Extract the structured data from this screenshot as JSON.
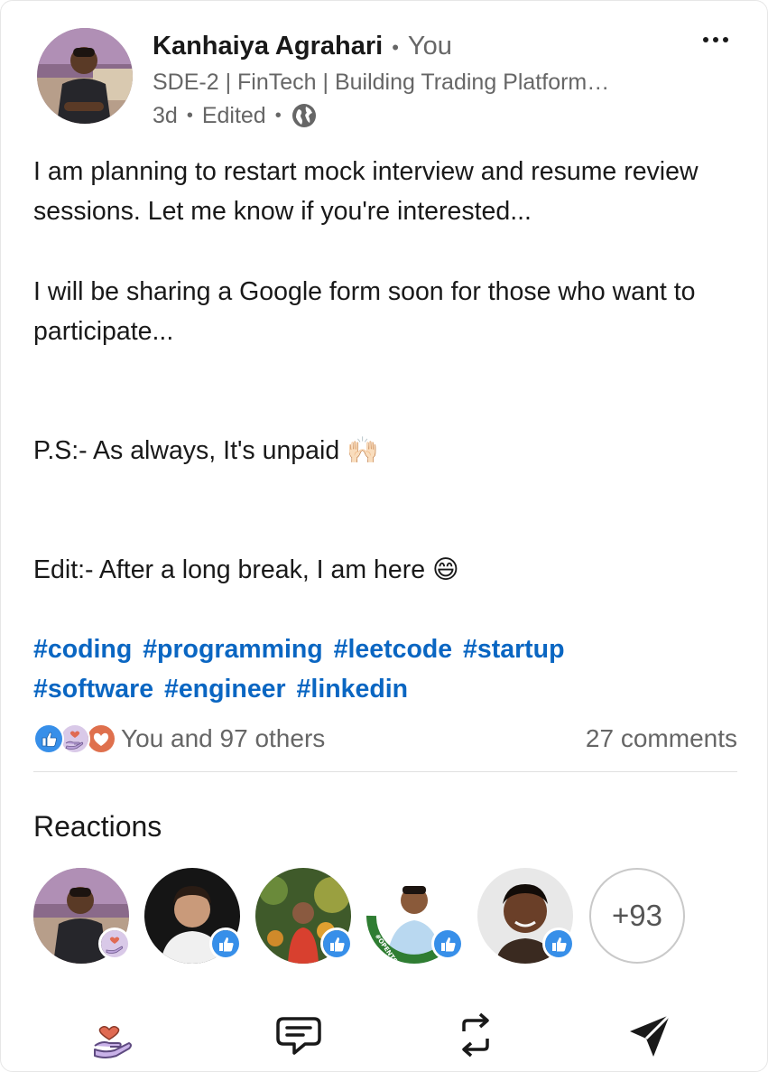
{
  "author": {
    "name": "Kanhaiya Agrahari",
    "relation_sep": "•",
    "relation": "You",
    "headline": "SDE-2 | FinTech | Building Trading Platform…",
    "age": "3d",
    "sep1": "•",
    "edited": "Edited",
    "sep2": "•",
    "visibility_icon": "globe-icon"
  },
  "post": {
    "paragraphs": [
      "I am planning to restart mock interview and resume review sessions. Let me know if you're interested...",
      "I will be sharing a Google form soon for those who want to participate...",
      "P.S:- As always, It's unpaid 🙌🏻",
      "Edit:- After a long break, I am here 😄"
    ],
    "hashtags": [
      "#coding",
      "#programming",
      "#leetcode",
      "#startup",
      "#software",
      "#engineer",
      "#linkedin"
    ]
  },
  "social": {
    "reaction_icons": [
      "like-icon",
      "support-icon",
      "love-icon"
    ],
    "reactions_text": "You and 97 others",
    "comments_text": "27 comments"
  },
  "reactions": {
    "title": "Reactions",
    "people": [
      {
        "name": "avatar-kanhaiya",
        "reaction": "support-icon"
      },
      {
        "name": "avatar-reactor-2",
        "reaction": "like-icon"
      },
      {
        "name": "avatar-reactor-3",
        "reaction": "like-icon"
      },
      {
        "name": "avatar-reactor-4",
        "reaction": "like-icon",
        "frame_text": "#OPENTOWORK"
      },
      {
        "name": "avatar-reactor-5",
        "reaction": "like-icon"
      }
    ],
    "more_label": "+93"
  },
  "actions": [
    "support-reaction-icon",
    "comment-icon",
    "repost-icon",
    "send-icon"
  ],
  "colors": {
    "accent": "#0a66c2",
    "text": "#191919",
    "muted": "#666666",
    "like_badge": "#378fe9",
    "opentowork_green": "#2f7d32"
  }
}
